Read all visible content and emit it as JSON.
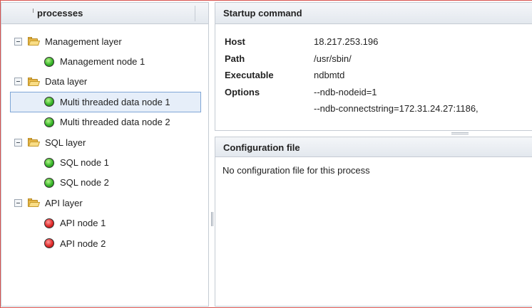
{
  "left_panel": {
    "title": "processes",
    "tree": [
      {
        "type": "layer",
        "label": "Management layer"
      },
      {
        "type": "node",
        "label": "Management node 1",
        "status": "green",
        "selected": false
      },
      {
        "type": "layer",
        "label": "Data layer"
      },
      {
        "type": "node",
        "label": "Multi threaded data node 1",
        "status": "green",
        "selected": true
      },
      {
        "type": "node",
        "label": "Multi threaded data node 2",
        "status": "green",
        "selected": false
      },
      {
        "type": "layer",
        "label": "SQL layer"
      },
      {
        "type": "node",
        "label": "SQL node 1",
        "status": "green",
        "selected": false
      },
      {
        "type": "node",
        "label": "SQL node 2",
        "status": "green",
        "selected": false
      },
      {
        "type": "layer",
        "label": "API layer"
      },
      {
        "type": "node",
        "label": "API node 1",
        "status": "red",
        "selected": false
      },
      {
        "type": "node",
        "label": "API node 2",
        "status": "red",
        "selected": false
      }
    ]
  },
  "startup": {
    "title": "Startup command",
    "rows": [
      {
        "key": "Host",
        "value": "18.217.253.196"
      },
      {
        "key": "Path",
        "value": "/usr/sbin/"
      },
      {
        "key": "Executable",
        "value": "ndbmtd"
      },
      {
        "key": "Options",
        "value": "--ndb-nodeid=1"
      },
      {
        "key": "",
        "value": "--ndb-connectstring=172.31.24.27:1186,"
      }
    ]
  },
  "config": {
    "title": "Configuration file",
    "message": "No configuration file for this process"
  },
  "colors": {
    "status_green": "#38b52a",
    "status_red": "#e02a2a",
    "selection": "#e6eef9",
    "frame": "#d9534f"
  }
}
